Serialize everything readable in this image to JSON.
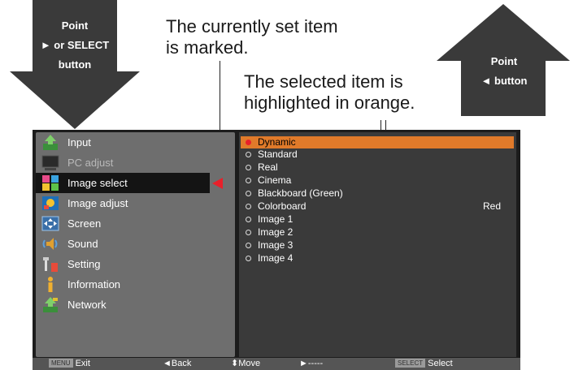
{
  "callouts": {
    "left_arrow": {
      "line1": "Point",
      "line2": "► or SELECT",
      "line3": "button"
    },
    "right_arrow": {
      "line1": "Point",
      "line2": "◄  button"
    },
    "marked_note": {
      "line1": "The currently set item",
      "line2": "is marked."
    },
    "highlight_note": {
      "line1": "The selected item is",
      "line2": "highlighted in orange."
    }
  },
  "colors": {
    "highlight": "#e07a2a",
    "marker": "#e8202a",
    "panel_left": "#6e6e6e",
    "panel_right": "#3a3a3a"
  },
  "menu": {
    "items": [
      {
        "label": "Input",
        "icon": "input-icon"
      },
      {
        "label": "PC adjust",
        "icon": "pc-adjust-icon"
      },
      {
        "label": "Image select",
        "icon": "image-select-icon"
      },
      {
        "label": "Image adjust",
        "icon": "image-adjust-icon"
      },
      {
        "label": "Screen",
        "icon": "screen-icon"
      },
      {
        "label": "Sound",
        "icon": "sound-icon"
      },
      {
        "label": "Setting",
        "icon": "setting-icon"
      },
      {
        "label": "Information",
        "icon": "information-icon"
      },
      {
        "label": "Network",
        "icon": "network-icon"
      }
    ],
    "active_index": 2
  },
  "options": {
    "items": [
      {
        "label": "Dynamic",
        "value": ""
      },
      {
        "label": "Standard",
        "value": ""
      },
      {
        "label": "Real",
        "value": ""
      },
      {
        "label": "Cinema",
        "value": ""
      },
      {
        "label": "Blackboard (Green)",
        "value": ""
      },
      {
        "label": "Colorboard",
        "value": "Red"
      },
      {
        "label": "Image 1",
        "value": ""
      },
      {
        "label": "Image 2",
        "value": ""
      },
      {
        "label": "Image 3",
        "value": ""
      },
      {
        "label": "Image 4",
        "value": ""
      }
    ],
    "highlighted_index": 0
  },
  "footer": {
    "exit_key": "MENU",
    "exit": "Exit",
    "back": "◄Back",
    "move": "⬍Move",
    "next": "►-----",
    "select_key": "SELECT",
    "select": "Select"
  }
}
